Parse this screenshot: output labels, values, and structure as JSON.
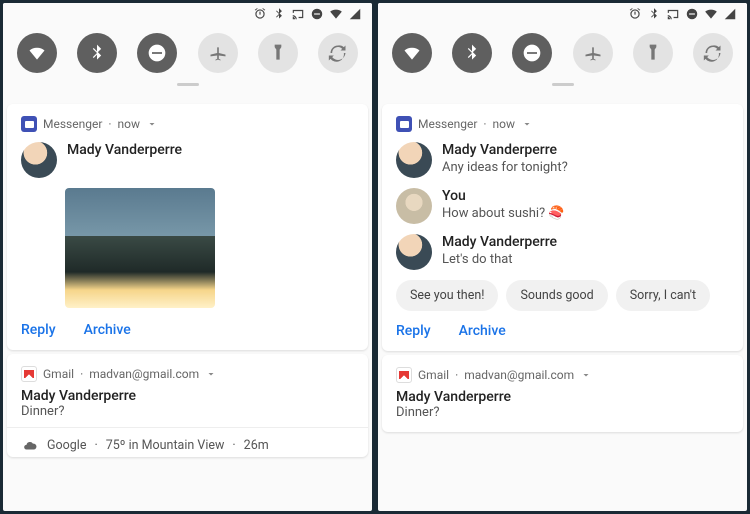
{
  "left": {
    "messenger": {
      "app": "Messenger",
      "time": "now",
      "sender": "Mady Vanderperre",
      "reply": "Reply",
      "archive": "Archive"
    },
    "gmail": {
      "app": "Gmail",
      "account": "madvan@gmail.com",
      "sender": "Mady Vanderperre",
      "subject": "Dinner?"
    },
    "weather": {
      "provider": "Google",
      "temp_loc": "75º in Mountain View",
      "age": "26m"
    }
  },
  "right": {
    "messenger": {
      "app": "Messenger",
      "time": "now",
      "thread": [
        {
          "name": "Mady Vanderperre",
          "text": "Any ideas for tonight?"
        },
        {
          "name": "You",
          "text": "How about sushi? 🍣"
        },
        {
          "name": "Mady Vanderperre",
          "text": "Let's do that"
        }
      ],
      "suggestions": [
        "See you then!",
        "Sounds good",
        "Sorry, I can't"
      ],
      "reply": "Reply",
      "archive": "Archive"
    },
    "gmail": {
      "app": "Gmail",
      "account": "madvan@gmail.com",
      "sender": "Mady Vanderperre",
      "subject": "Dinner?"
    }
  }
}
